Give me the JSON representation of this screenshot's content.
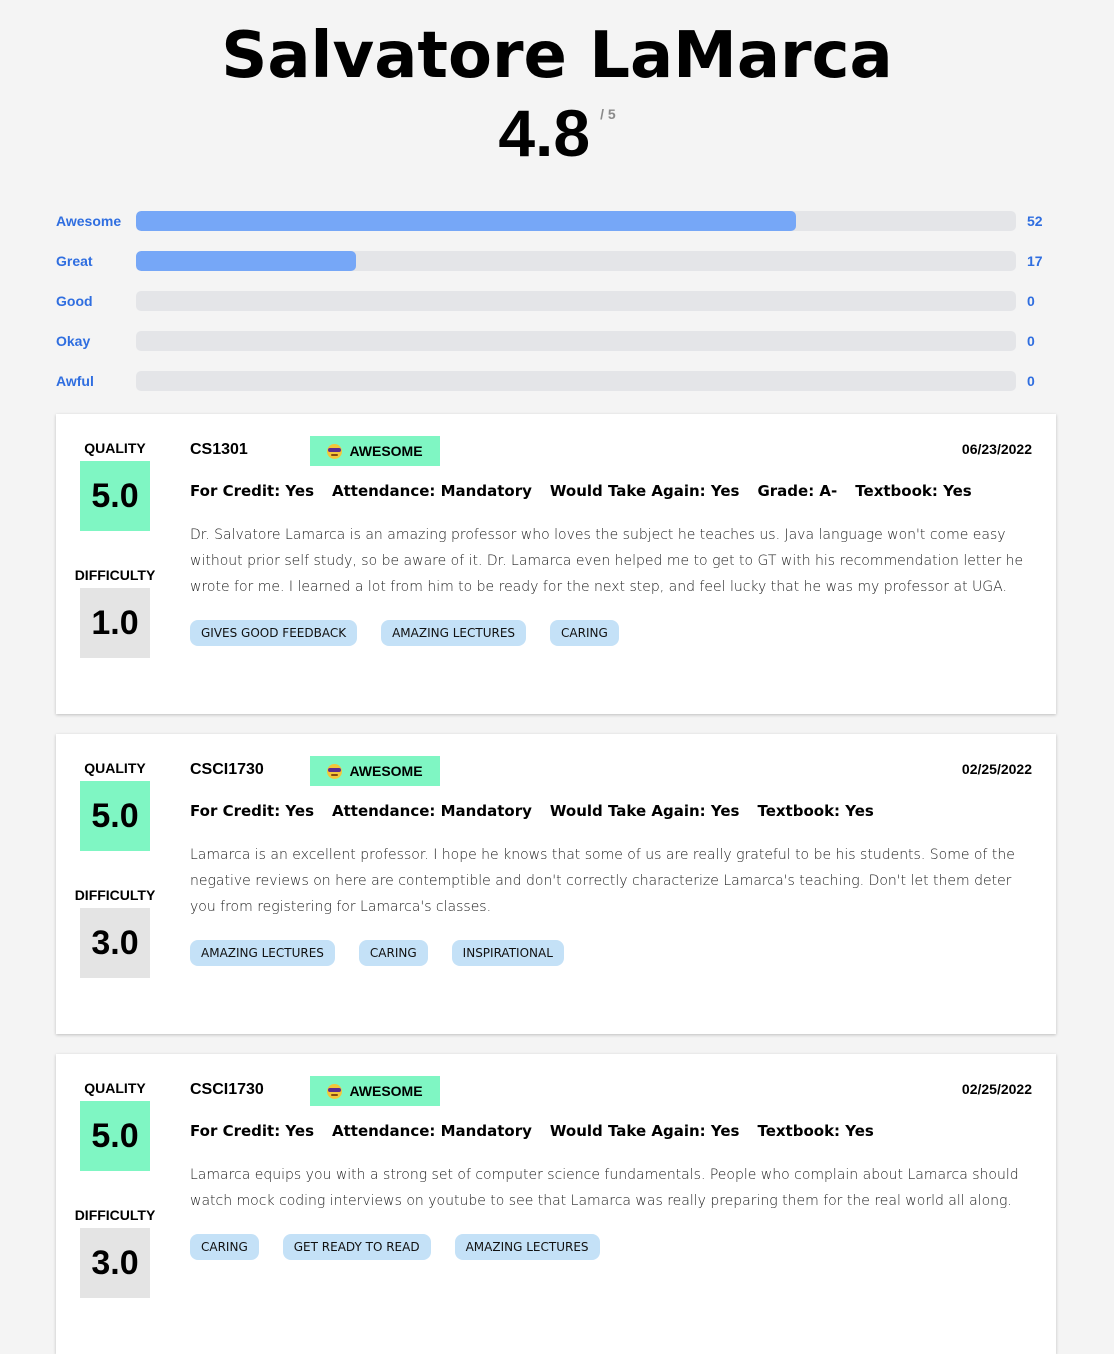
{
  "professor": {
    "name": "Salvatore LaMarca",
    "overall_rating": "4.8",
    "overall_max": "/ 5"
  },
  "distribution": [
    {
      "label": "Awesome",
      "count": "52",
      "fraction": 0.75
    },
    {
      "label": "Great",
      "count": "17",
      "fraction": 0.25
    },
    {
      "label": "Good",
      "count": "0",
      "fraction": 0
    },
    {
      "label": "Okay",
      "count": "0",
      "fraction": 0
    },
    {
      "label": "Awful",
      "count": "0",
      "fraction": 0
    }
  ],
  "labels": {
    "quality": "QUALITY",
    "difficulty": "DIFFICULTY"
  },
  "colors": {
    "accent": "#2f6ee0",
    "bar_fill": "#76a7f7",
    "quality_bg": "#7ff6c3",
    "difficulty_bg": "#e4e4e4",
    "tag_bg": "#c4e1f7"
  },
  "reviews": [
    {
      "quality": "5.0",
      "difficulty": "1.0",
      "course": "CS1301",
      "rating_label": "AWESOME",
      "rating_icon": "sunglasses-emoji-icon",
      "date": "06/23/2022",
      "meta": [
        "For Credit: Yes",
        "Attendance: Mandatory",
        "Would Take Again: Yes",
        "Grade: A-",
        "Textbook: Yes"
      ],
      "comment": "Dr. Salvatore Lamarca is an amazing professor who loves the subject he teaches us. Java language won't come easy without prior self study, so be aware of it. Dr. Lamarca even helped me to get to GT with his recommendation letter he wrote for me. I learned a lot from him to be ready for the next step, and feel lucky that he was my professor at UGA.",
      "tags": [
        "GIVES GOOD FEEDBACK",
        "AMAZING LECTURES",
        "CARING"
      ]
    },
    {
      "quality": "5.0",
      "difficulty": "3.0",
      "course": "CSCI1730",
      "rating_label": "AWESOME",
      "rating_icon": "sunglasses-emoji-icon",
      "date": "02/25/2022",
      "meta": [
        "For Credit: Yes",
        "Attendance: Mandatory",
        "Would Take Again: Yes",
        "Textbook: Yes"
      ],
      "comment": "Lamarca is an excellent professor. I hope he knows that some of us are really grateful to be his students. Some of the negative reviews on here are contemptible and don't correctly characterize Lamarca's teaching. Don't let them deter you from registering for Lamarca's classes.",
      "tags": [
        "AMAZING LECTURES",
        "CARING",
        "INSPIRATIONAL"
      ]
    },
    {
      "quality": "5.0",
      "difficulty": "3.0",
      "course": "CSCI1730",
      "rating_label": "AWESOME",
      "rating_icon": "sunglasses-emoji-icon",
      "date": "02/25/2022",
      "meta": [
        "For Credit: Yes",
        "Attendance: Mandatory",
        "Would Take Again: Yes",
        "Textbook: Yes"
      ],
      "comment": "Lamarca equips you with a strong set of computer science fundamentals. People who complain about Lamarca should watch mock coding interviews on youtube to see that Lamarca was really preparing them for the real world all along.",
      "tags": [
        "CARING",
        "GET READY TO READ",
        "AMAZING LECTURES"
      ]
    }
  ]
}
